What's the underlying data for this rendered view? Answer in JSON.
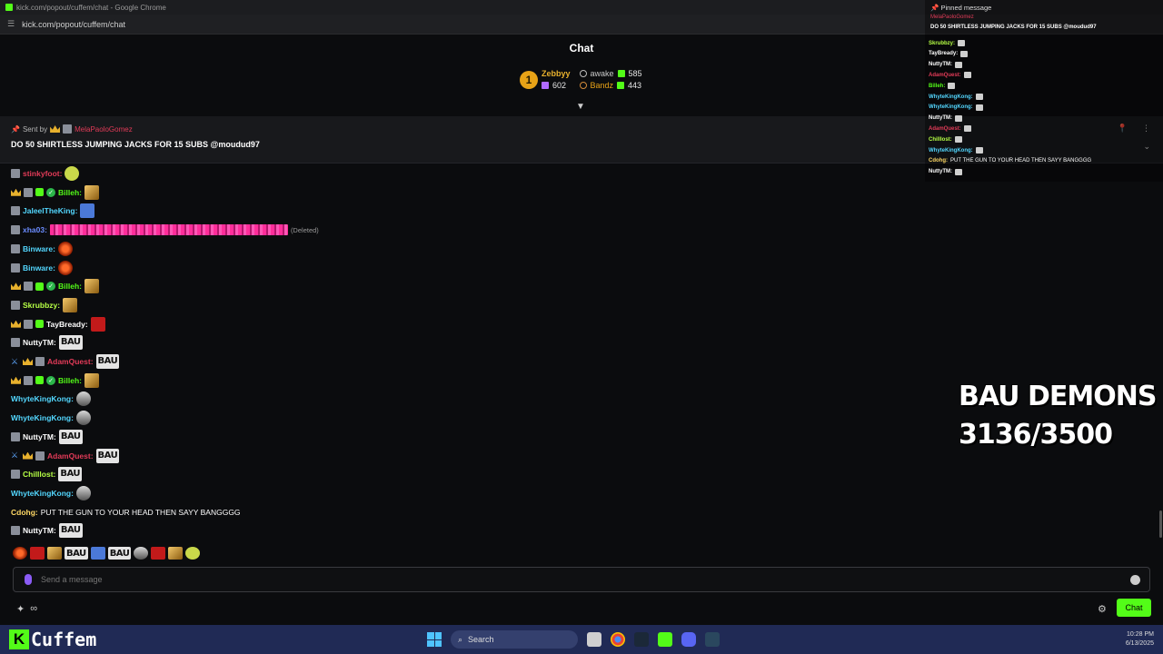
{
  "browser": {
    "window_title": "kick.com/popout/cuffem/chat - Google Chrome",
    "url": "kick.com/popout/cuffem/chat"
  },
  "header": {
    "title": "Chat",
    "leaderboard": {
      "first": {
        "rank": "1",
        "name": "Zebbyy",
        "gifts": "602"
      },
      "second": {
        "name": "awake",
        "gifts": "585"
      },
      "third": {
        "name": "Bandz",
        "gifts": "443"
      }
    }
  },
  "pinned": {
    "sent_by_label": "Sent by",
    "sender": "MelaPaoloGomez",
    "text": "DO 50 SHIRTLESS JUMPING JACKS FOR 15 SUBS @moudud97"
  },
  "colors": {
    "accent": "#53fc18",
    "bg": "#0b0c0e",
    "pinned_bg": "#18191c",
    "taskbar": "#202a55"
  },
  "messages": [
    {
      "user": "stinkyfoot",
      "color": "#e23b58",
      "badges": [
        "av"
      ],
      "emote": "sad"
    },
    {
      "user": "Billeh",
      "color": "#53fc18",
      "badges": [
        "crown",
        "av",
        "sub",
        "verified"
      ],
      "emote": "gold"
    },
    {
      "user": "JaleelTheKing",
      "color": "#53d7ff",
      "badges": [
        "av"
      ],
      "emote": "blue"
    },
    {
      "user": "xha03",
      "color": "#6b8cff",
      "badges": [
        "av"
      ],
      "emote": "spam",
      "deleted": "(Deleted)"
    },
    {
      "user": "Binware",
      "color": "#53d7ff",
      "badges": [
        "av"
      ],
      "emote": "red"
    },
    {
      "user": "Binware",
      "color": "#53d7ff",
      "badges": [
        "av"
      ],
      "emote": "red"
    },
    {
      "user": "Billeh",
      "color": "#53fc18",
      "badges": [
        "crown",
        "av",
        "sub",
        "verified"
      ],
      "emote": "gold"
    },
    {
      "user": "Skrubbzy",
      "color": "#b6ff45",
      "badges": [
        "av"
      ],
      "emote": "gold"
    },
    {
      "user": "TayBready",
      "color": "#ffffff",
      "badges": [
        "crown",
        "av",
        "sub"
      ],
      "emote": "redbox"
    },
    {
      "user": "NuttyTM",
      "color": "#ffffff",
      "badges": [
        "av"
      ],
      "emote": "bau",
      "emote_text": "BAU"
    },
    {
      "user": "AdamQuest",
      "color": "#e23b58",
      "badges": [
        "sword",
        "crown",
        "av"
      ],
      "emote": "bau",
      "emote_text": "BAU"
    },
    {
      "user": "Billeh",
      "color": "#53fc18",
      "badges": [
        "crown",
        "av",
        "sub",
        "verified"
      ],
      "emote": "gold"
    },
    {
      "user": "WhyteKingKong",
      "color": "#53d7ff",
      "badges": [],
      "emote": "face"
    },
    {
      "user": "WhyteKingKong",
      "color": "#53d7ff",
      "badges": [],
      "emote": "face"
    },
    {
      "user": "NuttyTM",
      "color": "#ffffff",
      "badges": [
        "av"
      ],
      "emote": "bau",
      "emote_text": "BAU"
    },
    {
      "user": "AdamQuest",
      "color": "#e23b58",
      "badges": [
        "sword",
        "crown",
        "av"
      ],
      "emote": "bau",
      "emote_text": "BAU"
    },
    {
      "user": "Chilllost",
      "color": "#b6ff45",
      "badges": [
        "av"
      ],
      "emote": "bau",
      "emote_text": "BAU"
    },
    {
      "user": "WhyteKingKong",
      "color": "#53d7ff",
      "badges": [],
      "emote": "face"
    },
    {
      "user": "Cdohg",
      "color": "#ffd966",
      "badges": [],
      "text": "PUT THE GUN TO YOUR HEAD THEN SAYY BANGGGG"
    },
    {
      "user": "NuttyTM",
      "color": "#ffffff",
      "badges": [
        "av"
      ],
      "emote": "bau",
      "emote_text": "BAU"
    }
  ],
  "emote_bar": [
    {
      "kind": "red"
    },
    {
      "kind": "redbox"
    },
    {
      "kind": "gold"
    },
    {
      "kind": "bau",
      "text": "BAU"
    },
    {
      "kind": "blue"
    },
    {
      "kind": "bau",
      "text": "BAU"
    },
    {
      "kind": "face"
    },
    {
      "kind": "redbox"
    },
    {
      "kind": "gold"
    },
    {
      "kind": "sad"
    }
  ],
  "composer": {
    "placeholder": "Send a message",
    "send_label": "Chat"
  },
  "overlay": {
    "header": "Pinned message",
    "sender": "MelaPaoloGomez",
    "pinned_text": "DO 50 SHIRTLESS JUMPING JACKS FOR 15 SUBS @moudud97",
    "messages": [
      {
        "user": "Skrubbzy",
        "color": "#b6ff45"
      },
      {
        "user": "TayBready",
        "color": "#ffffff"
      },
      {
        "user": "NuttyTM",
        "color": "#ffffff"
      },
      {
        "user": "AdamQuest",
        "color": "#e23b58"
      },
      {
        "user": "Billeh",
        "color": "#53fc18"
      },
      {
        "user": "WhyteKingKong",
        "color": "#53d7ff"
      },
      {
        "user": "WhyteKingKong",
        "color": "#53d7ff"
      },
      {
        "user": "NuttyTM",
        "color": "#ffffff"
      },
      {
        "user": "AdamQuest",
        "color": "#e23b58"
      },
      {
        "user": "Chilllost",
        "color": "#b6ff45"
      },
      {
        "user": "WhyteKingKong",
        "color": "#53d7ff"
      },
      {
        "user": "Cdohg",
        "color": "#ffd966",
        "text": "PUT THE GUN TO YOUR HEAD THEN SAYY BANGGGG"
      },
      {
        "user": "NuttyTM",
        "color": "#ffffff"
      }
    ]
  },
  "goal": {
    "line1": "BAU DEMONS",
    "line2": "3136/3500"
  },
  "branding": {
    "logo_letter": "K",
    "channel": "Cuffem"
  },
  "taskbar": {
    "search_label": "Search",
    "time": "10:28 PM",
    "date": "6/13/2025"
  }
}
